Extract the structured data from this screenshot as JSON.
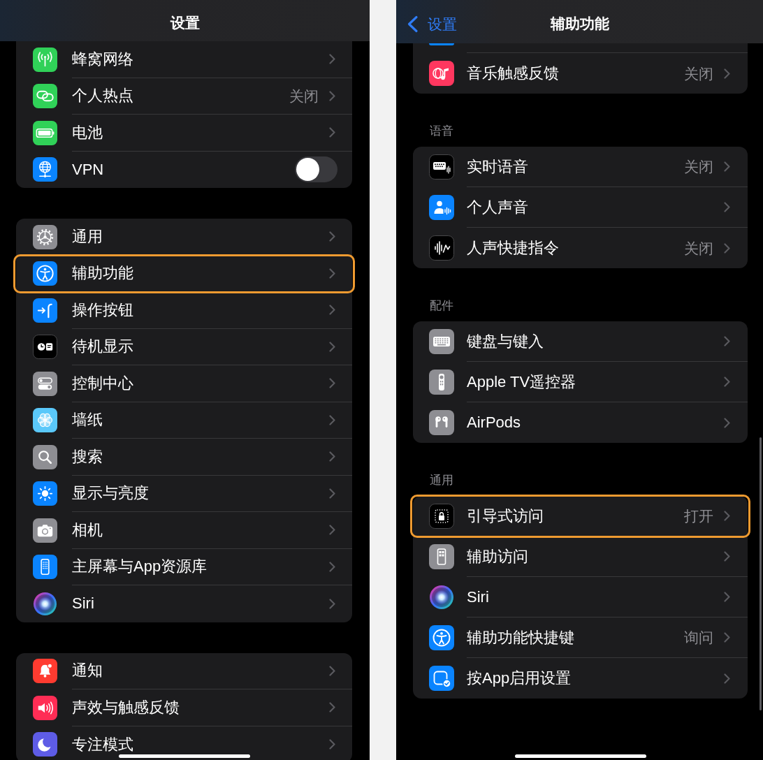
{
  "panels": [
    {
      "nav": {
        "title": "设置"
      },
      "groups": [
        {
          "cut_off": true,
          "rows": [
            {
              "label": "蜂窝网络",
              "kind": "link",
              "highlighted": false
            },
            {
              "label": "个人热点",
              "value": "关闭",
              "kind": "link",
              "highlighted": false
            },
            {
              "label": "电池",
              "kind": "link",
              "highlighted": false
            },
            {
              "label": "VPN",
              "kind": "toggle",
              "on": false,
              "highlighted": false
            }
          ]
        },
        {
          "cut_off": false,
          "rows": [
            {
              "label": "通用",
              "kind": "link",
              "highlighted": false
            },
            {
              "label": "辅助功能",
              "kind": "link",
              "highlighted": true
            },
            {
              "label": "操作按钮",
              "kind": "link",
              "highlighted": false
            },
            {
              "label": "待机显示",
              "kind": "link",
              "highlighted": false
            },
            {
              "label": "控制中心",
              "kind": "link",
              "highlighted": false
            },
            {
              "label": "墙纸",
              "kind": "link",
              "highlighted": false
            },
            {
              "label": "搜索",
              "kind": "link",
              "highlighted": false
            },
            {
              "label": "显示与亮度",
              "kind": "link",
              "highlighted": false
            },
            {
              "label": "相机",
              "kind": "link",
              "highlighted": false
            },
            {
              "label": "主屏幕与App资源库",
              "kind": "link",
              "highlighted": false
            },
            {
              "label": "Siri",
              "kind": "link",
              "highlighted": false
            }
          ]
        },
        {
          "cut_off": false,
          "rows": [
            {
              "label": "通知",
              "kind": "link",
              "highlighted": false
            },
            {
              "label": "声效与触感反馈",
              "kind": "link",
              "highlighted": false
            },
            {
              "label": "专注模式",
              "kind": "link",
              "highlighted": false
            }
          ]
        }
      ]
    },
    {
      "nav": {
        "back": "设置",
        "title": "辅助功能"
      },
      "groups": [
        {
          "cut_off": true,
          "rows": [
            {
              "kind": "clipped",
              "highlighted": false
            },
            {
              "label": "音乐触感反馈",
              "value": "关闭",
              "kind": "link",
              "highlighted": false
            }
          ]
        },
        {
          "cut_off": false,
          "header": "语音",
          "rows": [
            {
              "label": "实时语音",
              "value": "关闭",
              "kind": "link",
              "highlighted": false
            },
            {
              "label": "个人声音",
              "kind": "link",
              "highlighted": false
            },
            {
              "label": "人声快捷指令",
              "value": "关闭",
              "kind": "link",
              "highlighted": false
            }
          ]
        },
        {
          "cut_off": false,
          "header": "配件",
          "rows": [
            {
              "label": "键盘与键入",
              "kind": "link",
              "highlighted": false
            },
            {
              "label": "Apple TV遥控器",
              "kind": "link",
              "highlighted": false
            },
            {
              "label": "AirPods",
              "kind": "link",
              "highlighted": false
            }
          ]
        },
        {
          "cut_off": false,
          "header": "通用",
          "rows": [
            {
              "label": "引导式访问",
              "value": "打开",
              "kind": "link",
              "highlighted": true
            },
            {
              "label": "辅助访问",
              "kind": "link",
              "highlighted": false
            },
            {
              "label": "Siri",
              "kind": "link",
              "highlighted": false
            },
            {
              "label": "辅助功能快捷键",
              "value": "询问",
              "kind": "link",
              "highlighted": false
            },
            {
              "label": "按App启用设置",
              "kind": "link",
              "highlighted": false
            }
          ]
        }
      ]
    }
  ]
}
